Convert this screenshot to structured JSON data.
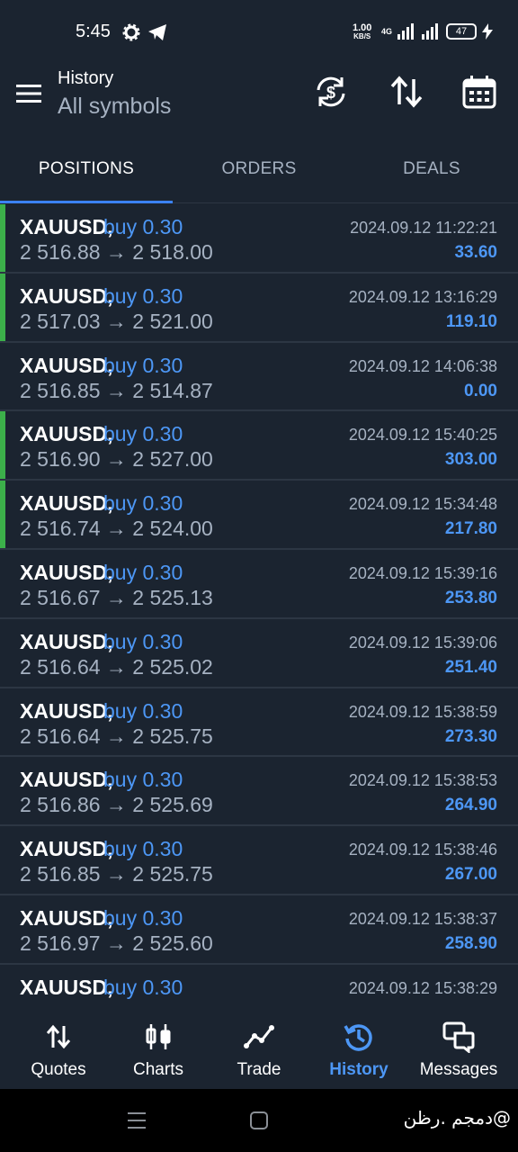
{
  "status_bar": {
    "time": "5:45",
    "speed_value": "1.00",
    "speed_unit": "KB/S",
    "network": "4G",
    "battery": "47"
  },
  "header": {
    "title": "History",
    "subtitle": "All symbols"
  },
  "tabs": [
    {
      "label": "POSITIONS",
      "active": true
    },
    {
      "label": "ORDERS",
      "active": false
    },
    {
      "label": "DEALS",
      "active": false
    }
  ],
  "positions": [
    {
      "symbol": "XAUUSD,",
      "side": "buy 0.30",
      "prices": "2 516.88 → 2 518.00",
      "time": "2024.09.12 11:22:21",
      "profit": "33.60",
      "marker": true
    },
    {
      "symbol": "XAUUSD,",
      "side": "buy 0.30",
      "prices": "2 517.03 → 2 521.00",
      "time": "2024.09.12 13:16:29",
      "profit": "119.10",
      "marker": true
    },
    {
      "symbol": "XAUUSD,",
      "side": "buy 0.30",
      "prices": "2 516.85 → 2 514.87",
      "time": "2024.09.12 14:06:38",
      "profit": "0.00",
      "marker": false
    },
    {
      "symbol": "XAUUSD,",
      "side": "buy 0.30",
      "prices": "2 516.90 → 2 527.00",
      "time": "2024.09.12 15:40:25",
      "profit": "303.00",
      "marker": true
    },
    {
      "symbol": "XAUUSD,",
      "side": "buy 0.30",
      "prices": "2 516.74 → 2 524.00",
      "time": "2024.09.12 15:34:48",
      "profit": "217.80",
      "marker": true
    },
    {
      "symbol": "XAUUSD,",
      "side": "buy 0.30",
      "prices": "2 516.67 → 2 525.13",
      "time": "2024.09.12 15:39:16",
      "profit": "253.80",
      "marker": false
    },
    {
      "symbol": "XAUUSD,",
      "side": "buy 0.30",
      "prices": "2 516.64 → 2 525.02",
      "time": "2024.09.12 15:39:06",
      "profit": "251.40",
      "marker": false
    },
    {
      "symbol": "XAUUSD,",
      "side": "buy 0.30",
      "prices": "2 516.64 → 2 525.75",
      "time": "2024.09.12 15:38:59",
      "profit": "273.30",
      "marker": false
    },
    {
      "symbol": "XAUUSD,",
      "side": "buy 0.30",
      "prices": "2 516.86 → 2 525.69",
      "time": "2024.09.12 15:38:53",
      "profit": "264.90",
      "marker": false
    },
    {
      "symbol": "XAUUSD,",
      "side": "buy 0.30",
      "prices": "2 516.85 → 2 525.75",
      "time": "2024.09.12 15:38:46",
      "profit": "267.00",
      "marker": false
    },
    {
      "symbol": "XAUUSD,",
      "side": "buy 0.30",
      "prices": "2 516.97 → 2 525.60",
      "time": "2024.09.12 15:38:37",
      "profit": "258.90",
      "marker": false
    },
    {
      "symbol": "XAUUSD,",
      "side": "buy 0.30",
      "prices": "",
      "time": "2024.09.12 15:38:29",
      "profit": "",
      "marker": false
    }
  ],
  "bottom_nav": [
    {
      "label": "Quotes",
      "icon": "quotes-icon",
      "active": false
    },
    {
      "label": "Charts",
      "icon": "charts-icon",
      "active": false
    },
    {
      "label": "Trade",
      "icon": "trade-icon",
      "active": false
    },
    {
      "label": "History",
      "icon": "history-icon",
      "active": true
    },
    {
      "label": "Messages",
      "icon": "messages-icon",
      "active": false
    }
  ],
  "watermark": "دمجم .رظن@",
  "colors": {
    "background": "#1b2430",
    "accent": "#4d97f5",
    "profit_marker": "#3cb04a",
    "muted_text": "#a6b2c2"
  }
}
